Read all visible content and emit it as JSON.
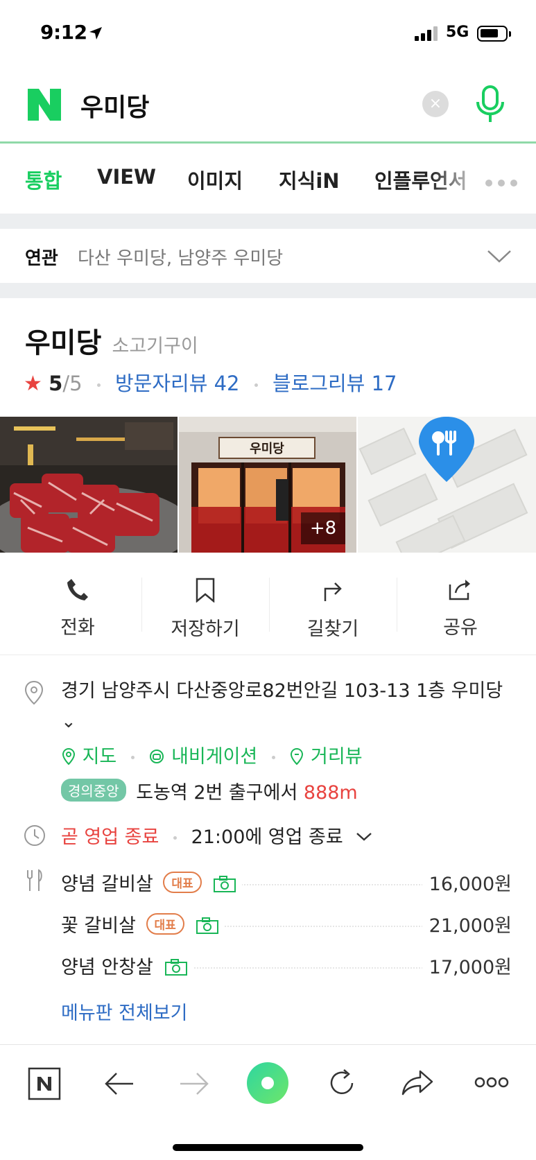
{
  "status": {
    "time": "9:12",
    "network": "5G"
  },
  "search": {
    "query": "우미당",
    "clear": "×"
  },
  "tabs": [
    "통합",
    "VIEW",
    "이미지",
    "지식iN",
    "인플루언서"
  ],
  "related": {
    "label": "연관",
    "items": "다산 우미당, 남양주 우미당"
  },
  "place": {
    "name": "우미당",
    "category": "소고기구이",
    "star": "★",
    "score": "5",
    "score_max": "/5",
    "visitor_reviews": "방문자리뷰 42",
    "blog_reviews": "블로그리뷰 17",
    "photo_count": "+8",
    "sign_text": "우미당"
  },
  "actions": {
    "call": "전화",
    "save": "저장하기",
    "directions": "길찾기",
    "share": "공유"
  },
  "info": {
    "address": "경기 남양주시 다산중앙로82번안길 103-13 1층 우미당",
    "address_toggle": "⌄",
    "map": "지도",
    "navigation": "내비게이션",
    "street_view": "거리뷰",
    "subway_line": "경의중앙",
    "subway_station": "도농역",
    "subway_exit": "2번 출구에서",
    "subway_distance": "888m",
    "closing_status": "곧 영업 종료",
    "closing_time": "21:00에 영업 종료",
    "menu_all": "메뉴판 전체보기"
  },
  "menu": [
    {
      "name": "양념 갈비살",
      "badge": "대표",
      "price": "16,000원"
    },
    {
      "name": "꽃 갈비살",
      "badge": "대표",
      "price": "21,000원"
    },
    {
      "name": "양념 안창살",
      "badge": "",
      "price": "17,000원"
    }
  ],
  "colors": {
    "naver_green": "#19ce60",
    "link_blue": "#2e6cc4",
    "alert_red": "#e8433f"
  }
}
